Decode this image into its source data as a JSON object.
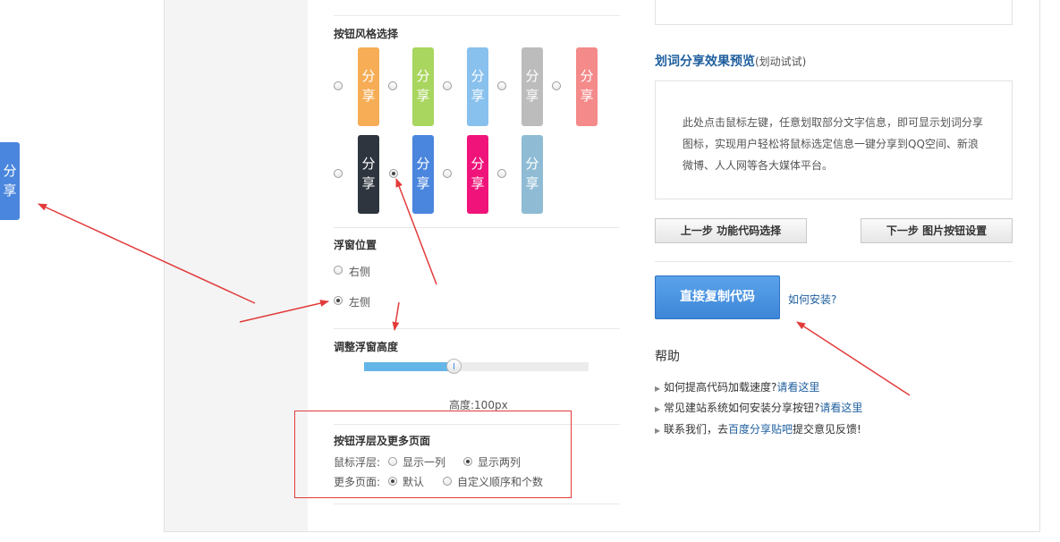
{
  "floating_share": {
    "chars": [
      "分",
      "享"
    ],
    "color": "#4a86de"
  },
  "button_style": {
    "title": "按钮风格选择",
    "row1": [
      {
        "chars": [
          "分",
          "享"
        ],
        "color": "#f6ad55",
        "selected": false
      },
      {
        "chars": [
          "分",
          "享"
        ],
        "color": "#a8d65e",
        "selected": false
      },
      {
        "chars": [
          "分",
          "享"
        ],
        "color": "#88c0ee",
        "selected": false
      },
      {
        "chars": [
          "分",
          "享"
        ],
        "color": "#bcbcbc",
        "selected": false
      },
      {
        "chars": [
          "分",
          "享"
        ],
        "color": "#f48a8a",
        "selected": false
      }
    ],
    "row2": [
      {
        "chars": [
          "分",
          "享"
        ],
        "color": "#2e353e",
        "selected": false
      },
      {
        "chars": [
          "分",
          "享"
        ],
        "color": "#4a86de",
        "selected": true
      },
      {
        "chars": [
          "分",
          "享"
        ],
        "color": "#f0147a",
        "selected": false
      },
      {
        "chars": [
          "分",
          "享"
        ],
        "color": "#8fbcd4",
        "selected": false
      }
    ]
  },
  "float_position": {
    "title": "浮窗位置",
    "options": [
      "右侧",
      "左侧"
    ],
    "selected": "左侧"
  },
  "float_height": {
    "title": "调整浮窗高度",
    "label": "高度:100px",
    "value_fraction": 0.4
  },
  "float_layer": {
    "title": "按钮浮层及更多页面",
    "hover_label": "鼠标浮层:",
    "hover_options": [
      "显示一列",
      "显示两列"
    ],
    "hover_selected": "显示两列",
    "more_label": "更多页面:",
    "more_options": [
      "默认",
      "自定义顺序和个数"
    ],
    "more_selected": "默认"
  },
  "preview": {
    "title": "划词分享效果预览",
    "subtitle": "(划动试试)",
    "lines": [
      "此处点击鼠标左键，任意划取部分文字信息，即可显示划词分享",
      "图标，实现用户轻松将鼠标选定信息一键分享到QQ空间、新浪",
      "微博、人人网等各大媒体平台。"
    ]
  },
  "nav": {
    "prev": "上一步 功能代码选择",
    "next": "下一步 图片按钮设置"
  },
  "copy": {
    "button": "直接复制代码",
    "install_link": "如何安装?"
  },
  "help": {
    "title": "帮助",
    "items": [
      {
        "text": "如何提高代码加载速度?",
        "link": "请看这里",
        "suffix": ""
      },
      {
        "text": "常见建站系统如何安装分享按钮?",
        "link": "请看这里",
        "suffix": ""
      },
      {
        "text": "联系我们，去",
        "link": "百度分享贴吧",
        "suffix": "提交意见反馈!"
      }
    ]
  },
  "colors": {
    "accent_blue": "#4a90e2",
    "annotation_red": "#e23b3b",
    "link": "#1f5f9e"
  }
}
